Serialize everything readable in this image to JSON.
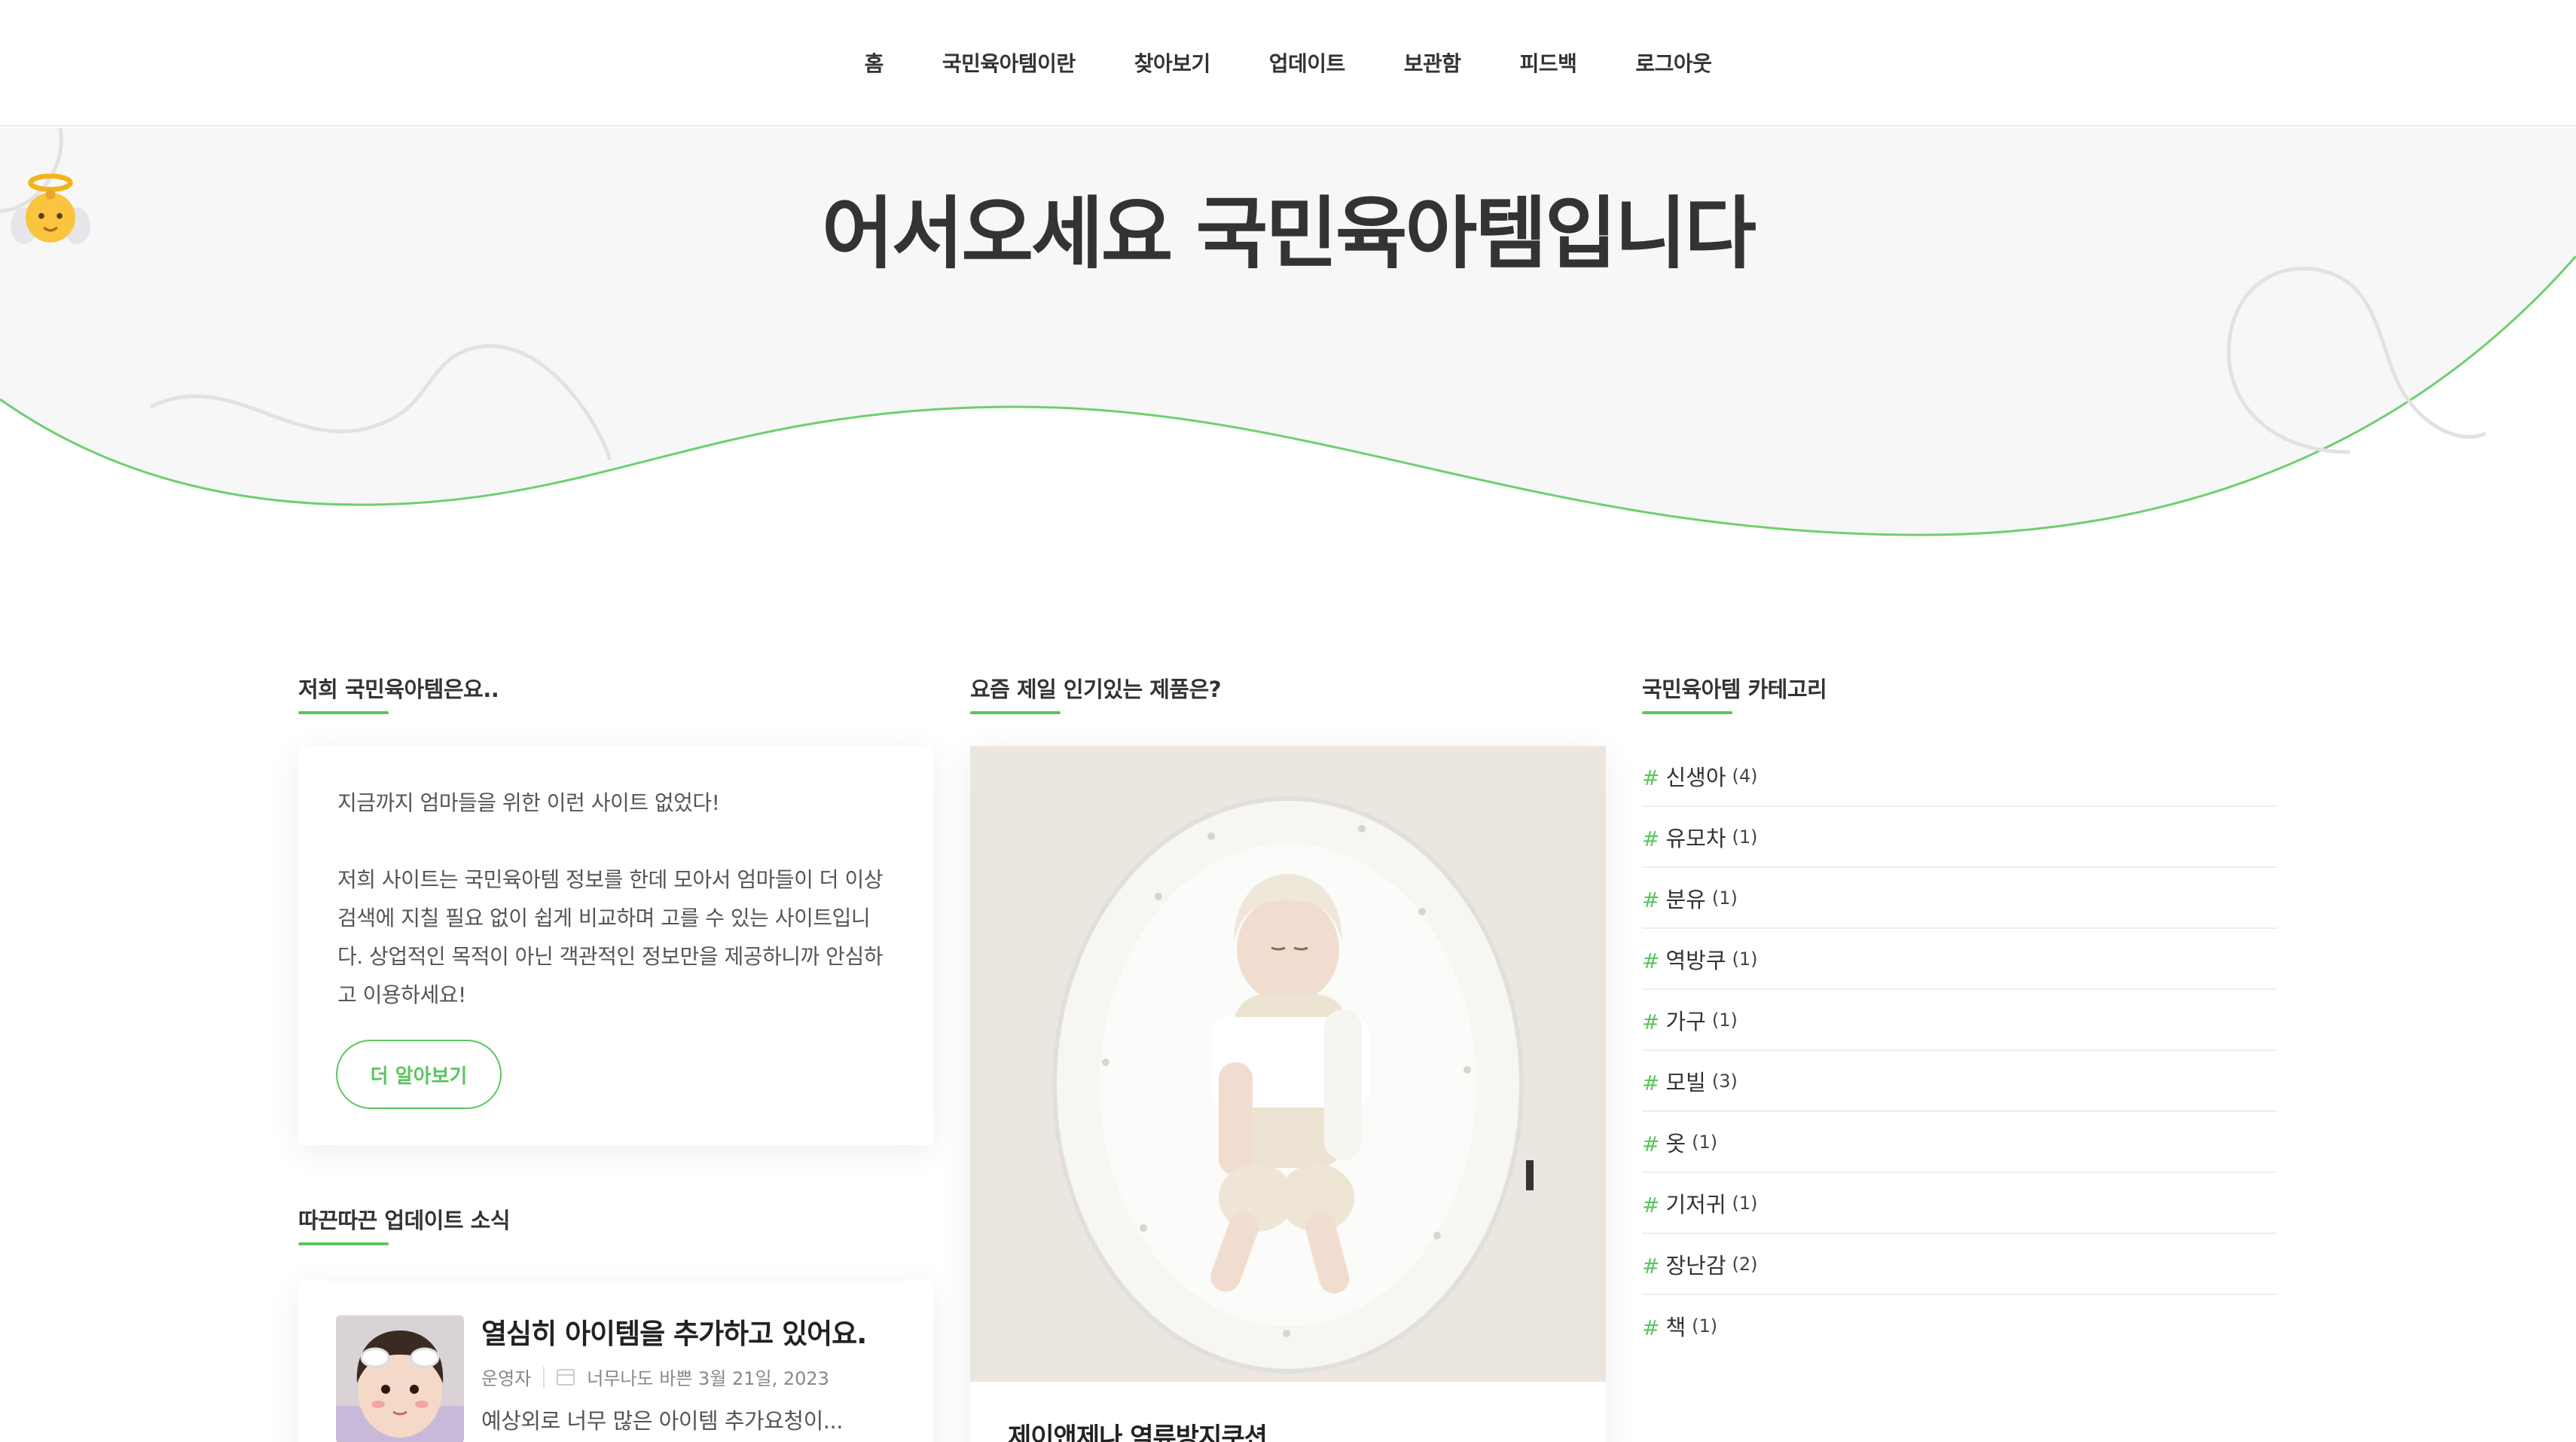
{
  "nav": {
    "items": [
      "홈",
      "국민육아템이란",
      "찾아보기",
      "업데이트",
      "보관함",
      "피드백",
      "로그아웃"
    ]
  },
  "hero": {
    "title": "어서오세요 국민육아템입니다"
  },
  "about": {
    "heading": "저희 국민육아템은요..",
    "paragraph1": "지금까지 엄마들을 위한 이런 사이트 없었다!",
    "paragraph2": "저희 사이트는 국민육아템 정보를 한데 모아서 엄마들이 더 이상 검색에 지칠 필요 없이 쉽게 비교하며 고를 수 있는 사이트입니다. 상업적인 목적이 아닌 객관적인 정보만을 제공하니까 안심하고 이용하세요!",
    "button": "더 알아보기"
  },
  "updates": {
    "heading": "따끈따끈 업데이트 소식",
    "post": {
      "title": "열심히 아이템을 추가하고 있어요.",
      "author": "운영자",
      "date": "너무나도 바쁜 3월 21일, 2023",
      "excerpt": "예상외로 너무 많은 아이템 추가요청이..."
    }
  },
  "popular": {
    "heading": "요즘 제일 인기있는 제품은?",
    "product_name": "제이앤제나 역류방지쿠션"
  },
  "categories": {
    "heading": "국민육아템 카테고리",
    "items": [
      {
        "name": "신생아",
        "count": "(4)"
      },
      {
        "name": "유모차",
        "count": "(1)"
      },
      {
        "name": "분유",
        "count": "(1)"
      },
      {
        "name": "역방쿠",
        "count": "(1)"
      },
      {
        "name": "가구",
        "count": "(1)"
      },
      {
        "name": "모빌",
        "count": "(3)"
      },
      {
        "name": "옷",
        "count": "(1)"
      },
      {
        "name": "기저귀",
        "count": "(1)"
      },
      {
        "name": "장난감",
        "count": "(2)"
      },
      {
        "name": "책",
        "count": "(1)"
      }
    ]
  },
  "colors": {
    "accent": "#5cc55f",
    "hero_bg": "#f7f7f7",
    "text": "#333333"
  }
}
